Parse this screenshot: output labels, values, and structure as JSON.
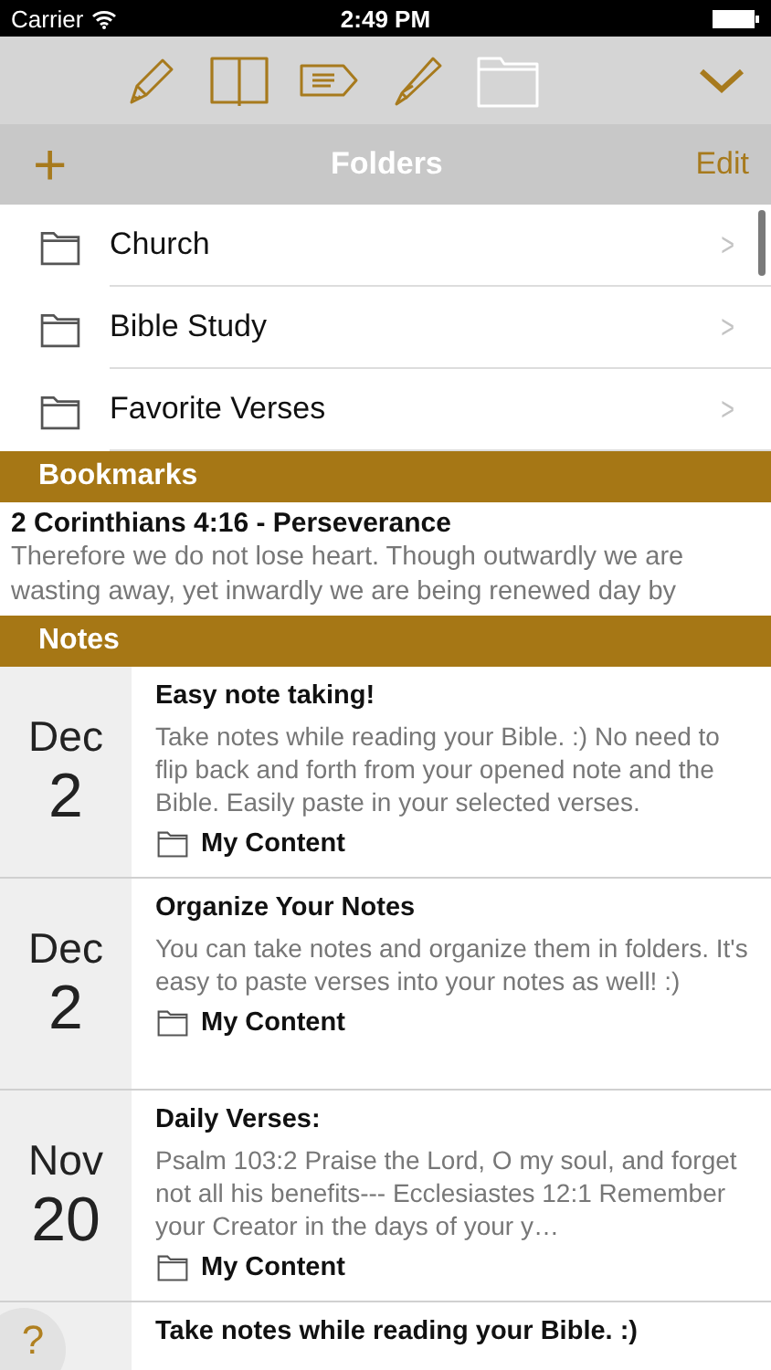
{
  "status_bar": {
    "carrier": "Carrier",
    "time": "2:49 PM"
  },
  "toolbar": {
    "tools": [
      {
        "kind": "pencil",
        "selected": false
      },
      {
        "kind": "book",
        "selected": false
      },
      {
        "kind": "tag",
        "selected": false
      },
      {
        "kind": "highlighter",
        "selected": false
      },
      {
        "kind": "folder",
        "selected": true
      }
    ]
  },
  "folders_header": {
    "add": "+",
    "title": "Folders",
    "edit": "Edit"
  },
  "folders": [
    {
      "name": "Church",
      "chevron": ">"
    },
    {
      "name": "Bible Study",
      "chevron": ">"
    },
    {
      "name": "Favorite Verses",
      "chevron": ">"
    }
  ],
  "bookmarks": {
    "title": "Bookmarks",
    "items": [
      {
        "reference": "2 Corinthians 4:16 - Perseverance",
        "text": "Therefore we do not lose heart. Though outwardly we are wasting away, yet inwardly we are being renewed day by"
      }
    ]
  },
  "notes": {
    "title": "Notes",
    "items": [
      {
        "month": "Dec",
        "day": "2",
        "title": "Easy note taking!",
        "body": "Take notes while reading your Bible. :)   No need to flip back and forth from your opened note and the Bible. Easily paste in your selected verses.",
        "folder": "My Content"
      },
      {
        "month": "Dec",
        "day": "2",
        "title": "Organize Your Notes",
        "body": "You can take notes and organize them in folders. It's easy to paste verses into your notes as well! :)",
        "folder": "My Content"
      },
      {
        "month": "Nov",
        "day": "20",
        "title": "Daily Verses:",
        "body": "Psalm 103:2 Praise the Lord, O my soul, and forget not all his benefits---  Ecclesiastes 12:1 Remember your Creator in the days of your y…",
        "folder": "My Content"
      },
      {
        "title": "Take notes while reading your Bible. :)"
      }
    ]
  },
  "help_button": "?"
}
